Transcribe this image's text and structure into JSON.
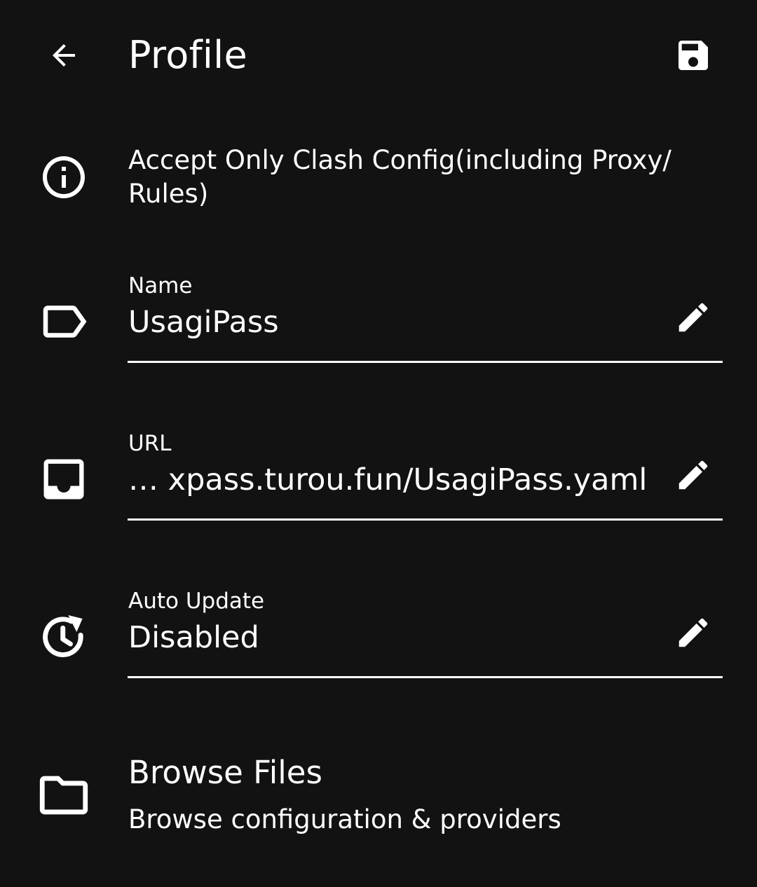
{
  "app_bar": {
    "back_icon": "arrow-back-icon",
    "title": "Profile",
    "save_icon": "save-icon"
  },
  "info": {
    "icon": "info-icon",
    "line1": "Accept Only Clash Config(including Proxy/",
    "line2": "Rules)"
  },
  "fields": {
    "name": {
      "icon": "label-tag-icon",
      "label": "Name",
      "value": "UsagiPass",
      "edit_icon": "edit-pencil-icon"
    },
    "url": {
      "icon": "inbox-tray-icon",
      "label": "URL",
      "value": "… xpass.turou.fun/UsagiPass.yaml",
      "edit_icon": "edit-pencil-icon"
    },
    "auto_update": {
      "icon": "clock-refresh-icon",
      "label": "Auto Update",
      "value": "Disabled",
      "edit_icon": "edit-pencil-icon"
    }
  },
  "browse": {
    "icon": "folder-icon",
    "title": "Browse Files",
    "subtitle": "Browse configuration & providers"
  },
  "colors": {
    "background": "#121212",
    "foreground": "#ffffff"
  }
}
